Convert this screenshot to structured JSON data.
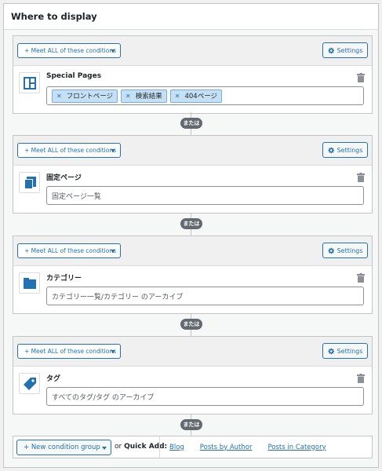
{
  "panel": {
    "title": "Where to display"
  },
  "groups": [
    {
      "match_label": "+ Meet ALL of these conditions",
      "settings_label": "Settings",
      "condition": {
        "title": "Special Pages",
        "icon": "layout-grid-icon",
        "placeholder": "",
        "tags": [
          "フロントページ",
          "検索結果",
          "404ページ"
        ]
      }
    },
    {
      "match_label": "+ Meet ALL of these conditions",
      "settings_label": "Settings",
      "condition": {
        "title": "固定ページ",
        "icon": "pages-icon",
        "placeholder": "固定ページ一覧",
        "tags": []
      }
    },
    {
      "match_label": "+ Meet ALL of these conditions",
      "settings_label": "Settings",
      "condition": {
        "title": "カテゴリー",
        "icon": "folder-icon",
        "placeholder": "カテゴリー一覧/カテゴリー のアーカイブ",
        "tags": []
      }
    },
    {
      "match_label": "+ Meet ALL of these conditions",
      "settings_label": "Settings",
      "condition": {
        "title": "タグ",
        "icon": "tag-icon",
        "placeholder": "すべてのタグ/タグ のアーカイブ",
        "tags": []
      }
    }
  ],
  "or_label": "または",
  "footer": {
    "new_group_label": "+ New condition group",
    "or_text": "or",
    "quick_add_label": "Quick Add:",
    "quick_links": [
      "Blog",
      "Posts by Author",
      "Posts in Category"
    ]
  },
  "colors": {
    "accent": "#2271b1",
    "tag_bg": "#c5e0f5",
    "or_pill": "#646970"
  }
}
